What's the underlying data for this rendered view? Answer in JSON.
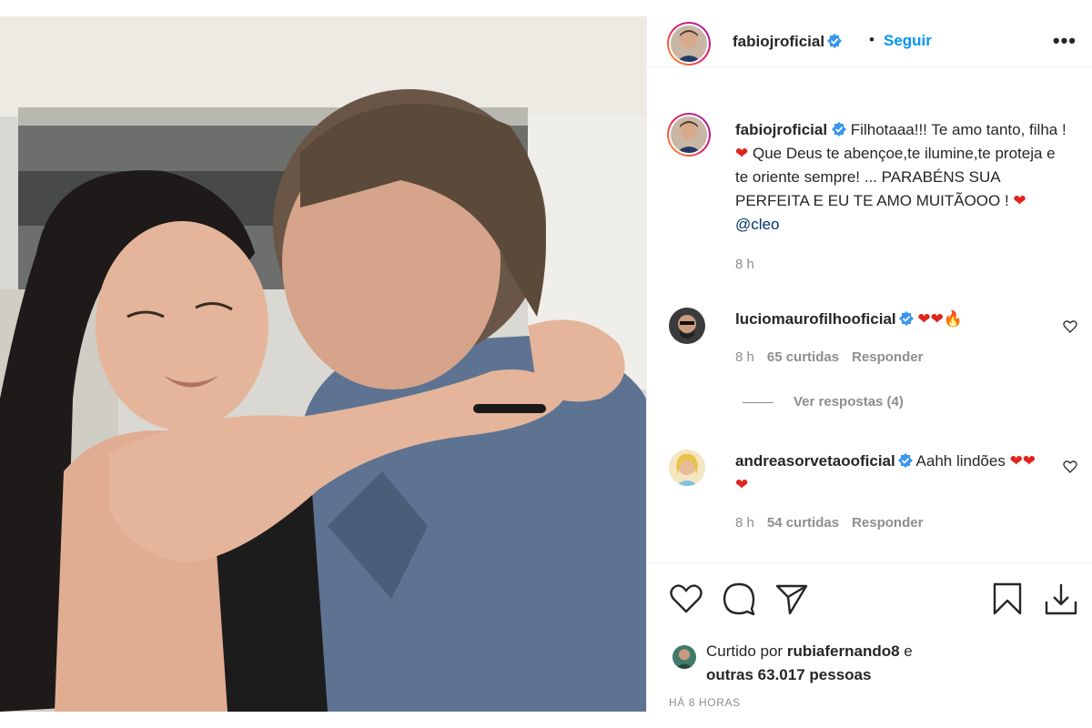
{
  "post": {
    "author": "fabiojroficial",
    "follow_label": "Seguir",
    "separator": "•",
    "more_label": "•••"
  },
  "caption": {
    "username": "fabiojroficial",
    "text_part1": " Filhotaaa!!! Te amo tanto, filha ! ",
    "text_part2": " Que Deus te abençoe,te ilumine,te proteja e te oriente sempre! ... PARABÉNS SUA PERFEITA E EU TE AMO MUITÃOOO ! ",
    "mention": "@cleo",
    "time": "8 h"
  },
  "comments": [
    {
      "username": "luciomaurofilhooficial",
      "text": "",
      "emoji": "❤❤🔥",
      "time": "8 h",
      "likes": "65 curtidas",
      "reply": "Responder"
    },
    {
      "username": "andreasorvetaooficial",
      "text": " Aahh lindões ",
      "emoji": "❤❤❤",
      "time": "8 h",
      "likes": "54 curtidas",
      "reply": "Responder"
    }
  ],
  "view_replies": "Ver respostas (4)",
  "likes": {
    "prefix": "Curtido por ",
    "user": "rubiafernando8",
    "middle": " e",
    "others": "outras 63.017 pessoas"
  },
  "posted_ago": "HÁ 8 HORAS",
  "icons": {
    "like": "heart-icon",
    "comment": "comment-icon",
    "share": "paper-plane-icon",
    "save": "bookmark-icon",
    "download": "download-icon",
    "verified": "verified-badge-icon",
    "more": "more-options-icon"
  },
  "colors": {
    "accent": "#0095f6",
    "verified": "#3897f0",
    "heart": "#e0241d",
    "muted": "#8e8e8e"
  }
}
